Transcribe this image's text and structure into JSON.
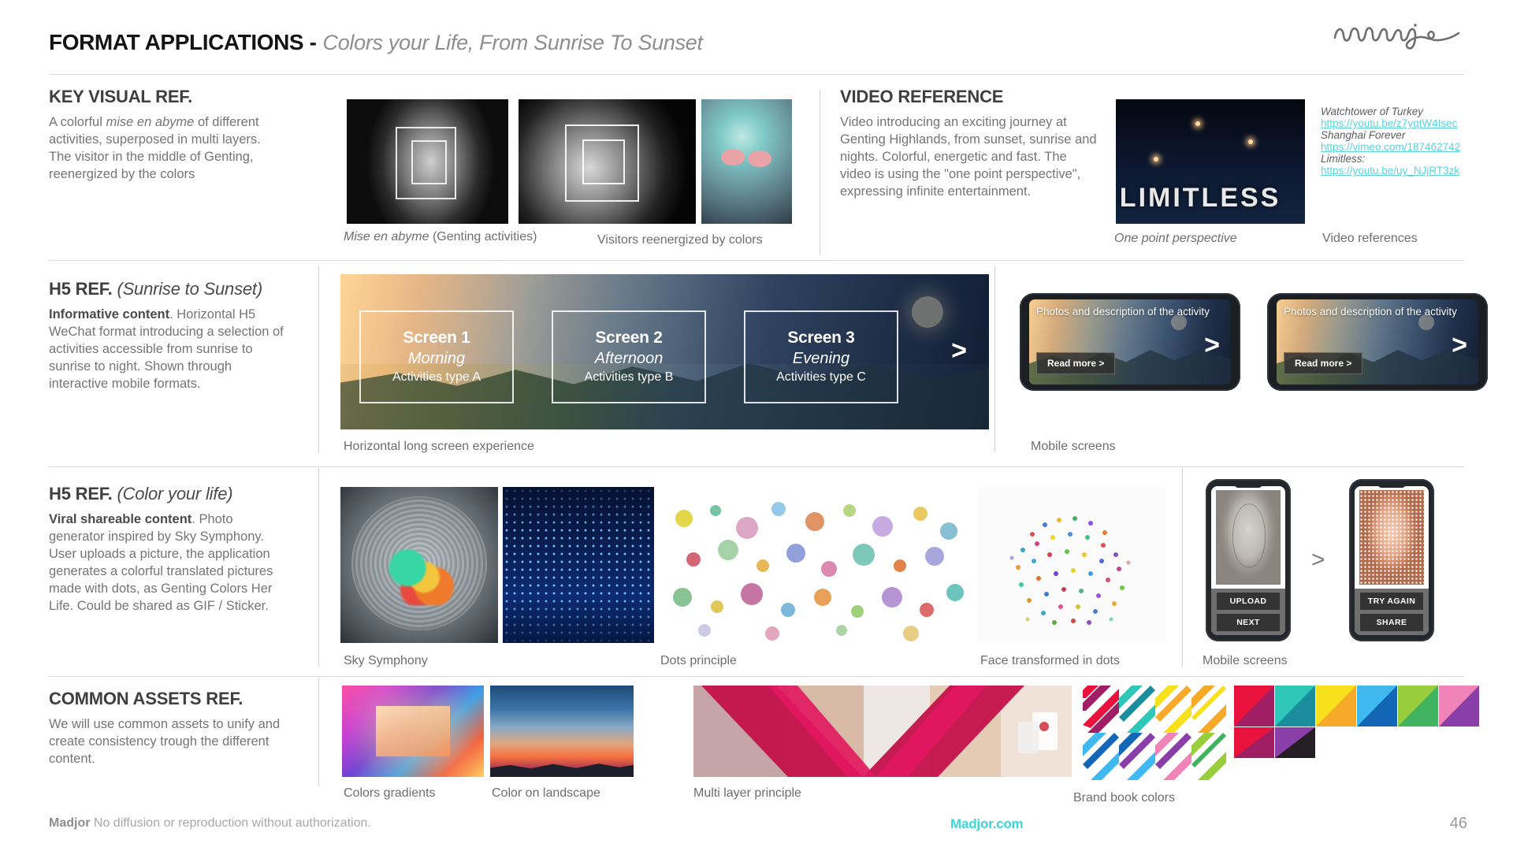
{
  "header": {
    "title_main": "FORMAT APPLICATIONS -",
    "title_sub": "Colors your Life, From Sunrise To Sunset",
    "logo_alt": "soulignac-signature-logo"
  },
  "sections": {
    "key_visual": {
      "heading": "KEY VISUAL REF.",
      "body_before": "A colorful ",
      "body_italic": "mise en abyme",
      "body_after": " of different activities, superposed in multi layers. The visitor in the middle of Genting, reenergized by the colors",
      "captions": {
        "c1_italic": "Mise en abyme",
        "c1_rest": " (Genting activities)",
        "c2": "Visitors reenergized by colors"
      }
    },
    "video_reference": {
      "heading": "VIDEO REFERENCE",
      "body": "Video introducing an exciting journey at Genting Highlands, from sunset, sunrise and nights. Colorful, energetic and fast. The video is using the \"one point perspective\", expressing infinite entertainment.",
      "image_text": "LIMITLESS",
      "caption_image": "One point perspective",
      "caption_links": "Video references",
      "links": [
        {
          "title": "Watchtower of Turkey",
          "url": "https://youtu.be/z7yqtW4Isec"
        },
        {
          "title": "Shanghai Forever",
          "url": "https://vimeo.com/187462742"
        },
        {
          "title": "Limitless:",
          "url": "https://youtu.be/uy_NJjRT3zk"
        }
      ]
    },
    "h5_sunrise": {
      "heading_bold": "H5 REF.",
      "heading_italic": "(Sunrise to Sunset)",
      "body_bold": "Informative content",
      "body_rest": ". Horizontal H5 WeChat format introducing a selection of activities accessible from sunrise to sunrise to night. Shown through interactive mobile formats.",
      "screens": [
        {
          "title": "Screen 1",
          "time": "Morning",
          "sub": "Activities type A"
        },
        {
          "title": "Screen 2",
          "time": "Afternoon",
          "sub": "Activities type B"
        },
        {
          "title": "Screen 3",
          "time": "Evening",
          "sub": "Activities type C"
        }
      ],
      "banner_chevron": ">",
      "caption_banner": "Horizontal long screen experience",
      "caption_mobile": "Mobile screens",
      "phone": {
        "overlay_text": "Photos and description of the activity",
        "button": "Read more >",
        "chevron": ">"
      }
    },
    "h5_color": {
      "heading_bold": "H5 REF.",
      "heading_italic": "(Color your life)",
      "body_bold": "Viral shareable content",
      "body_rest": ". Photo generator inspired by Sky Symphony. User uploads a picture, the application generates a colorful translated pictures made with dots, as Genting Colors Her Life. Could be shared as GIF / Sticker.",
      "captions": {
        "c1": "Sky Symphony",
        "c2": "Dots principle",
        "c3": "Face transformed in dots",
        "c4": "Mobile screens"
      },
      "phones": {
        "left_buttons": [
          "UPLOAD",
          "NEXT"
        ],
        "right_buttons": [
          "TRY AGAIN",
          "SHARE"
        ],
        "arrow": ">"
      }
    },
    "common_assets": {
      "heading": "COMMON ASSETS REF.",
      "body": "We will use common assets to unify and create consistency trough the different content.",
      "captions": {
        "c1": "Colors gradients",
        "c2": "Color on landscape",
        "c3": "Multi layer principle",
        "c4": "Brand book colors"
      },
      "brand_colors_row1": [
        [
          "#e8123c",
          "#a01e63"
        ],
        [
          "#2fc7b8",
          "#1a8d9c"
        ],
        [
          "#f7e01c",
          "#f7a929"
        ],
        [
          "#3fb9ef",
          "#1266b5"
        ],
        [
          "#98cd3c",
          "#3fb35f"
        ],
        [
          "#f084b8",
          "#8a3fa8"
        ]
      ],
      "brand_colors_row2": [
        [
          "#e8123c",
          "#a01e63"
        ],
        [
          "#8a3fa8",
          "#231f25"
        ]
      ]
    }
  },
  "footer": {
    "brand": "Madjor",
    "notice": " No diffusion or reproduction without authorization.",
    "site": "Madjor.com",
    "page": "46"
  },
  "colors": {
    "accent_cyan": "#3fd4d8",
    "link_cyan": "#5ad3dd",
    "rule_gray": "#d7d7d7",
    "heading_gray": "#3f3f3f",
    "body_gray": "#757575"
  }
}
